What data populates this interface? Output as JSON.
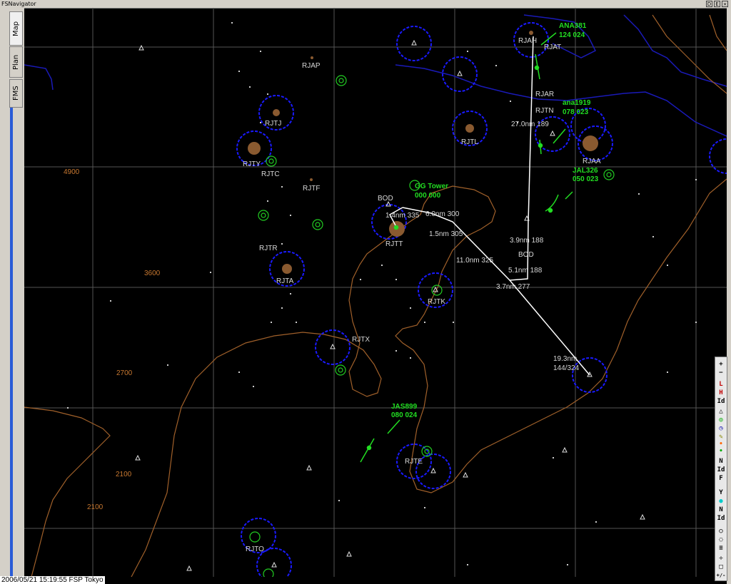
{
  "window": {
    "title": "FSNavigator",
    "buttons": [
      "D",
      "E",
      "×"
    ]
  },
  "tabs": [
    {
      "label": "Map",
      "active": true
    },
    {
      "label": "Plan",
      "active": false
    },
    {
      "label": "FMS",
      "active": false
    }
  ],
  "status_bar": "2006/05/21 15:19:55 FSP Tokyo",
  "colors": {
    "background": "#000000",
    "grid": "#5a5a5a",
    "terrain_contour": "#a0602a",
    "coastline": "#1010a0",
    "vor_circle": "#1a1aff",
    "traffic": "#22dd22",
    "route": "#ffffff",
    "label": "#d8d8d8",
    "elevation": "#c87830"
  },
  "airports": [
    {
      "id": "RJAP"
    },
    {
      "id": "RJTJ"
    },
    {
      "id": "RJTY"
    },
    {
      "id": "RJTC"
    },
    {
      "id": "RJTF"
    },
    {
      "id": "RJTR"
    },
    {
      "id": "RJTA"
    },
    {
      "id": "RJTT"
    },
    {
      "id": "RJTK"
    },
    {
      "id": "RJTX"
    },
    {
      "id": "RJTE"
    },
    {
      "id": "RJTO"
    },
    {
      "id": "RJAA"
    },
    {
      "id": "RJTL"
    },
    {
      "id": "RJAH"
    },
    {
      "id": "RJAT"
    },
    {
      "id": "RJAR"
    },
    {
      "id": "RJTN"
    }
  ],
  "elevations": [
    "4900",
    "3600",
    "2700",
    "2100",
    "2100"
  ],
  "traffic": [
    {
      "callsign": "ANA381",
      "data": "124  024"
    },
    {
      "callsign": "ana1919",
      "data": "078  023"
    },
    {
      "callsign": "JAL326",
      "data": "050  023"
    },
    {
      "callsign": "GG Tower",
      "data": "000  000"
    },
    {
      "callsign": "JAS899",
      "data": "080  024"
    }
  ],
  "route_legs": [
    "27.0nm 189",
    "1.4nm 335",
    "6.0nm 300",
    "1.5nm 305",
    "11.0nm 325",
    "3.9nm 188",
    "5.1nm 188",
    "3.7nm 277",
    "19.3nm",
    "144/324"
  ],
  "waypoints": [
    "BOD",
    "BOD"
  ],
  "toolbar": [
    "+",
    "−",
    "L",
    "H",
    "Id",
    "△",
    "◎",
    "◷",
    "✎",
    "•",
    "•",
    "N",
    "Id",
    "F",
    "Y",
    "●",
    "N",
    "Id",
    "○",
    "◌",
    "≡",
    "✛",
    "□",
    "+/-"
  ]
}
